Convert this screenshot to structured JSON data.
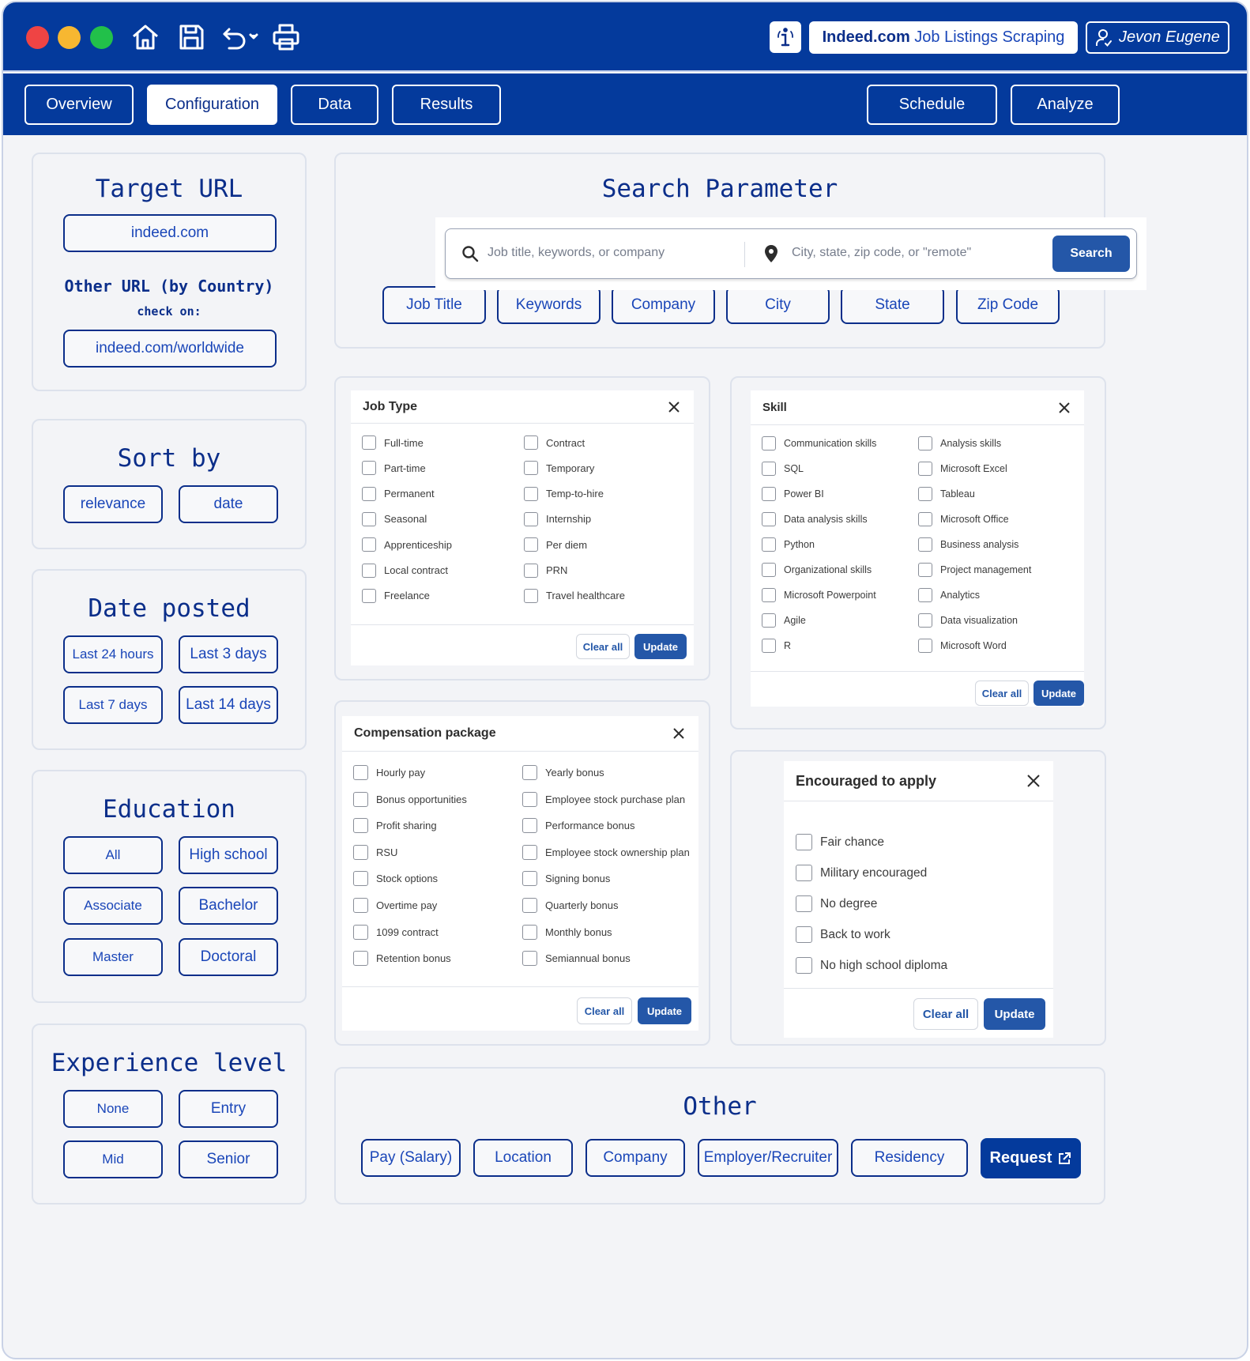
{
  "app": {
    "title_brand": "Indeed.com",
    "title_rest": "Job Listings Scraping",
    "user": "Jevon Eugene"
  },
  "nav": {
    "tabs": [
      "Overview",
      "Configuration",
      "Data",
      "Results"
    ],
    "right": [
      "Schedule",
      "Analyze"
    ]
  },
  "target_url": {
    "title": "Target URL",
    "primary": "indeed.com",
    "other_label": "Other URL (by Country)",
    "check_on": "check on:",
    "worldwide": "indeed.com/worldwide"
  },
  "sort_by": {
    "title": "Sort by",
    "options": [
      "relevance",
      "date"
    ]
  },
  "date_posted": {
    "title": "Date posted",
    "options": [
      "Last 24 hours",
      "Last 3 days",
      "Last 7 days",
      "Last 14 days"
    ]
  },
  "education": {
    "title": "Education",
    "options": [
      "All",
      "High school",
      "Associate",
      "Bachelor",
      "Master",
      "Doctoral"
    ]
  },
  "experience": {
    "title": "Experience level",
    "options": [
      "None",
      "Entry",
      "Mid",
      "Senior"
    ]
  },
  "search": {
    "title": "Search Parameter",
    "what_placeholder": "Job title, keywords, or company",
    "where_placeholder": "City, state, zip code, or \"remote\"",
    "button": "Search",
    "params": [
      "Job Title",
      "Keywords",
      "Company",
      "City",
      "State",
      "Zip Code"
    ]
  },
  "job_type": {
    "title": "Job Type",
    "col1": [
      "Full-time",
      "Part-time",
      "Permanent",
      "Seasonal",
      "Apprenticeship",
      "Local contract",
      "Freelance"
    ],
    "col2": [
      "Contract",
      "Temporary",
      "Temp-to-hire",
      "Internship",
      "Per diem",
      "PRN",
      "Travel healthcare"
    ],
    "clear": "Clear all",
    "update": "Update"
  },
  "skill": {
    "title": "Skill",
    "col1": [
      "Communication skills",
      "SQL",
      "Power BI",
      "Data analysis skills",
      "Python",
      "Organizational skills",
      "Microsoft Powerpoint",
      "Agile",
      "R"
    ],
    "col2": [
      "Analysis skills",
      "Microsoft Excel",
      "Tableau",
      "Microsoft Office",
      "Business analysis",
      "Project management",
      "Analytics",
      "Data visualization",
      "Microsoft Word"
    ],
    "clear": "Clear all",
    "update": "Update"
  },
  "compensation": {
    "title": "Compensation package",
    "col1": [
      "Hourly pay",
      "Bonus opportunities",
      "Profit sharing",
      "RSU",
      "Stock options",
      "Overtime pay",
      "1099 contract",
      "Retention bonus"
    ],
    "col2": [
      "Yearly bonus",
      "Employee stock purchase plan",
      "Performance bonus",
      "Employee stock ownership plan",
      "Signing bonus",
      "Quarterly bonus",
      "Monthly bonus",
      "Semiannual bonus"
    ],
    "clear": "Clear all",
    "update": "Update"
  },
  "encouraged": {
    "title": "Encouraged to apply",
    "options": [
      "Fair chance",
      "Military encouraged",
      "No degree",
      "Back to work",
      "No high school diploma"
    ],
    "clear": "Clear all",
    "update": "Update"
  },
  "other": {
    "title": "Other",
    "options": [
      "Pay (Salary)",
      "Location",
      "Company",
      "Employer/Recruiter",
      "Residency"
    ],
    "request": "Request"
  },
  "colors": {
    "brand": "#043a9c",
    "accent": "#2457a8",
    "panel_bg": "#f3f4f7"
  },
  "icons": [
    "home-icon",
    "save-icon",
    "undo-icon",
    "print-icon",
    "info-icon",
    "user-icon",
    "search-icon",
    "location-pin-icon",
    "close-icon",
    "external-link-icon"
  ]
}
